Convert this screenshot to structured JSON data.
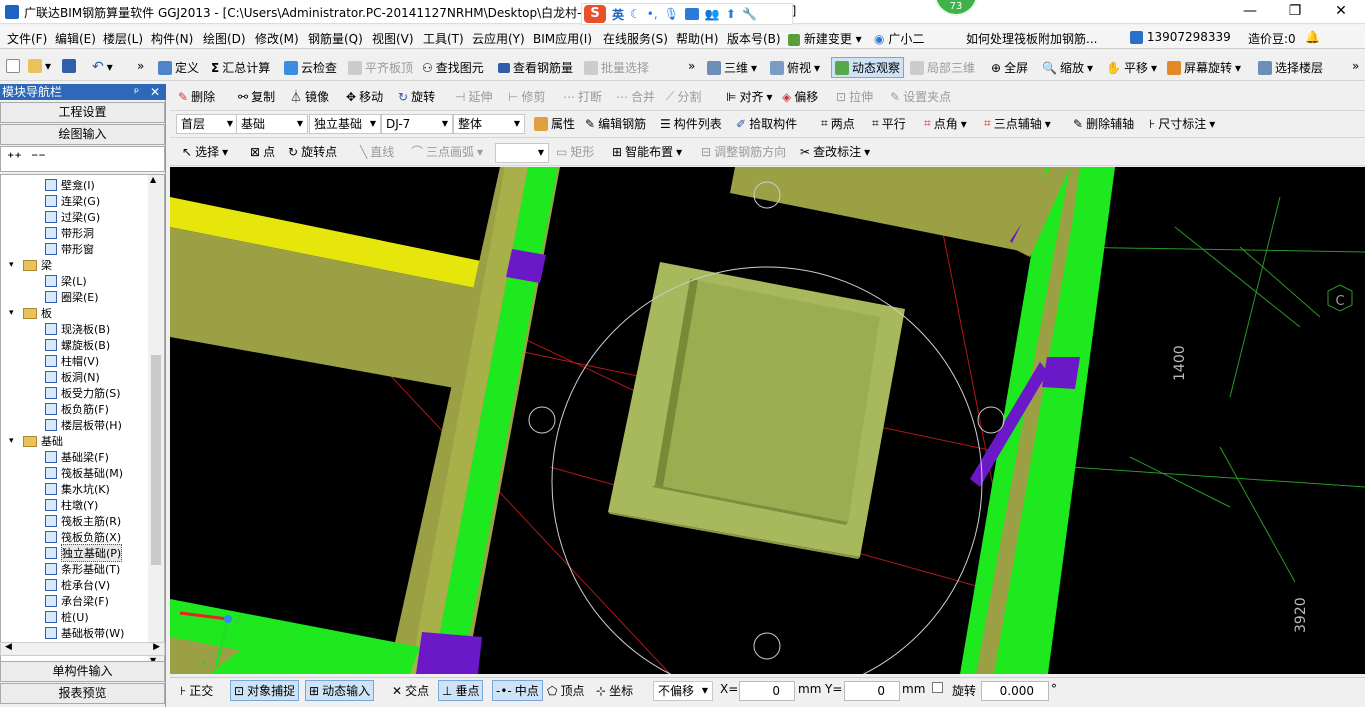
{
  "titlebar": {
    "title": "广联达BIM钢筋算量软件 GGJ2013 - [C:\\Users\\Administrator.PC-20141127NRHM\\Desktop\\白龙村-",
    "title_suffix": "2]",
    "ime_lang": "英",
    "badge": "73",
    "min": "—",
    "restore": "❐",
    "close": "✕"
  },
  "menubar": {
    "items": [
      "文件(F)",
      "编辑(E)",
      "楼层(L)",
      "构件(N)",
      "绘图(D)",
      "修改(M)",
      "钢筋量(Q)",
      "视图(V)",
      "工具(T)",
      "云应用(Y)",
      "BIM应用(I)",
      "在线服务(S)",
      "帮助(H)",
      "版本号(B)"
    ],
    "new_change": "新建变更",
    "assistant": "广小二",
    "question": "如何处理筏板附加钢筋...",
    "phone": "13907298339",
    "beans": "造价豆:0"
  },
  "toolbar1": {
    "define": "定义",
    "sum": "汇总计算",
    "cloud_check": "云检查",
    "flat_top": "平齐板顶",
    "find": "查找图元",
    "view_rebar": "查看钢筋量",
    "batch": "批量选择",
    "view3d": "三维",
    "top_view": "俯视",
    "dynamic": "动态观察",
    "local3d": "局部三维",
    "fullscreen": "全屏",
    "zoom": "缩放",
    "pan": "平移",
    "rotate_screen": "屏幕旋转",
    "select_floor": "选择楼层"
  },
  "panel": {
    "header": "模块导航栏",
    "pin": "ᵖ",
    "close": "✕",
    "project_settings": "工程设置",
    "draw_input": "绘图输入",
    "single_input": "单构件输入",
    "report": "报表预览",
    "tree": [
      {
        "label": "壁龛(I)",
        "level": 2
      },
      {
        "label": "连梁(G)",
        "level": 2
      },
      {
        "label": "过梁(G)",
        "level": 2
      },
      {
        "label": "带形洞",
        "level": 2
      },
      {
        "label": "带形窗",
        "level": 2
      },
      {
        "label": "梁",
        "level": 1
      },
      {
        "label": "梁(L)",
        "level": 2
      },
      {
        "label": "圈梁(E)",
        "level": 2
      },
      {
        "label": "板",
        "level": 1
      },
      {
        "label": "现浇板(B)",
        "level": 2
      },
      {
        "label": "螺旋板(B)",
        "level": 2
      },
      {
        "label": "柱帽(V)",
        "level": 2
      },
      {
        "label": "板洞(N)",
        "level": 2
      },
      {
        "label": "板受力筋(S)",
        "level": 2
      },
      {
        "label": "板负筋(F)",
        "level": 2
      },
      {
        "label": "楼层板带(H)",
        "level": 2
      },
      {
        "label": "基础",
        "level": 1
      },
      {
        "label": "基础梁(F)",
        "level": 2
      },
      {
        "label": "筏板基础(M)",
        "level": 2
      },
      {
        "label": "集水坑(K)",
        "level": 2
      },
      {
        "label": "柱墩(Y)",
        "level": 2
      },
      {
        "label": "筏板主筋(R)",
        "level": 2
      },
      {
        "label": "筏板负筋(X)",
        "level": 2
      },
      {
        "label": "独立基础(P)",
        "level": 2
      },
      {
        "label": "条形基础(T)",
        "level": 2
      },
      {
        "label": "桩承台(V)",
        "level": 2
      },
      {
        "label": "承台梁(F)",
        "level": 2
      },
      {
        "label": "桩(U)",
        "level": 2
      },
      {
        "label": "基础板带(W)",
        "level": 2
      }
    ]
  },
  "toolbar2": {
    "delete": "删除",
    "copy": "复制",
    "mirror": "镜像",
    "move": "移动",
    "rotate": "旋转",
    "extend": "延伸",
    "trim": "修剪",
    "break": "打断",
    "merge": "合并",
    "split": "分割",
    "align": "对齐",
    "offset": "偏移",
    "stretch": "拉伸",
    "set_grip": "设置夹点"
  },
  "toolbar3": {
    "floor": "首层",
    "category": "基础",
    "type": "独立基础",
    "component": "DJ-7",
    "part": "整体",
    "properties": "属性",
    "edit_rebar": "编辑钢筋",
    "component_list": "构件列表",
    "pick": "拾取构件",
    "two_points": "两点",
    "parallel": "平行",
    "point_angle": "点角",
    "three_point_axis": "三点辅轴",
    "delete_axis": "删除辅轴",
    "dimension": "尺寸标注"
  },
  "toolbar4": {
    "select": "选择",
    "point": "点",
    "rotate_point": "旋转点",
    "line": "直线",
    "arc": "三点画弧",
    "rect": "矩形",
    "smart_layout": "智能布置",
    "adjust_rebar": "调整钢筋方向",
    "check_label": "查改标注"
  },
  "viewport": {
    "dim_1400": "1400",
    "dim_3920": "3920",
    "axis_label": "C",
    "axis_y": "Y",
    "axis_z": "Z",
    "colors": {
      "bg": "#000000",
      "green": "#1ee81e",
      "yellow": "#e2e30a",
      "olive": "#9aa043",
      "pad": "#a3b55a",
      "purple": "#6b18c9"
    }
  },
  "statusbar": {
    "ortho": "正交",
    "snap": "对象捕捉",
    "dyn_input": "动态输入",
    "intersection": "交点",
    "perpendicular": "垂点",
    "midpoint": "中点",
    "vertex": "顶点",
    "coord": "坐标",
    "offset_mode": "不偏移",
    "x_label": "X=",
    "x_value": "0",
    "y_label": "Y=",
    "y_value": "0",
    "unit": "mm",
    "rotate_label": "旋转",
    "rotate_value": "0.000",
    "degree": "°"
  }
}
